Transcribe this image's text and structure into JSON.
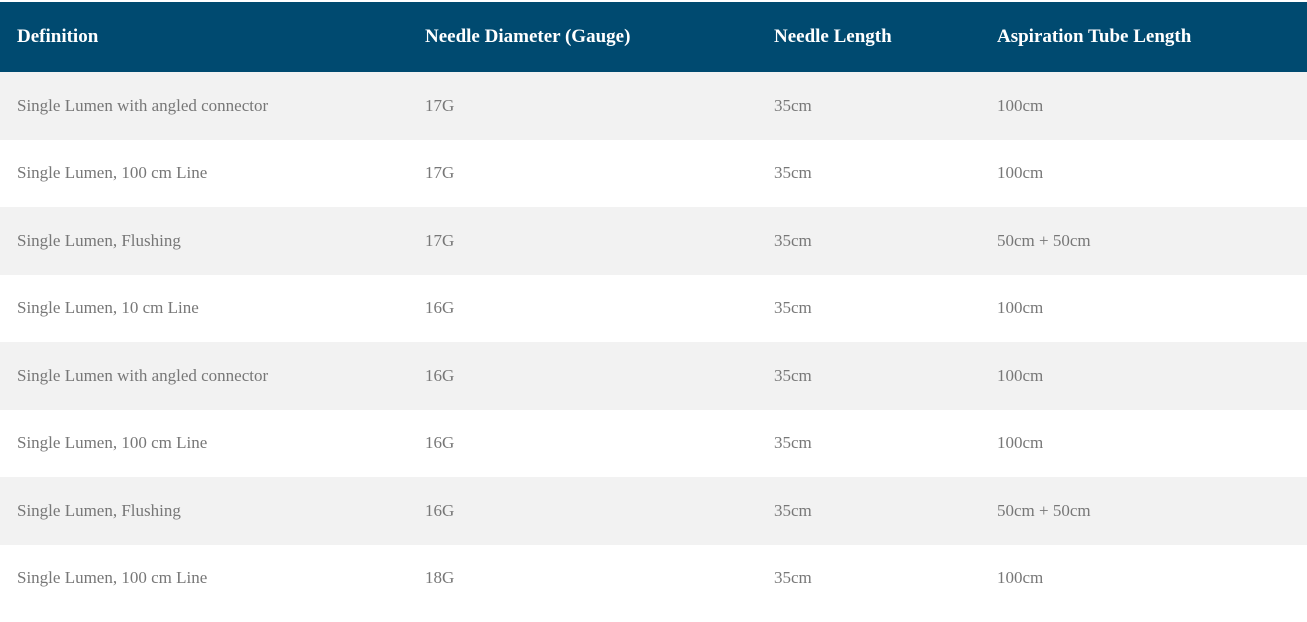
{
  "table": {
    "headers": [
      "Definition",
      "Needle Diameter (Gauge)",
      "Needle Length",
      "Aspiration Tube Length"
    ],
    "rows": [
      [
        "Single Lumen with angled connector",
        "17G",
        "35cm",
        "100cm"
      ],
      [
        "Single Lumen, 100 cm Line",
        "17G",
        "35cm",
        "100cm"
      ],
      [
        "Single Lumen, Flushing",
        "17G",
        "35cm",
        "50cm + 50cm"
      ],
      [
        "Single Lumen, 10 cm Line",
        "16G",
        "35cm",
        "100cm"
      ],
      [
        "Single Lumen with angled connector",
        "16G",
        "35cm",
        "100cm"
      ],
      [
        "Single Lumen, 100 cm Line",
        "16G",
        "35cm",
        "100cm"
      ],
      [
        "Single Lumen, Flushing",
        "16G",
        "35cm",
        "50cm + 50cm"
      ],
      [
        "Single Lumen, 100 cm Line",
        "18G",
        "35cm",
        "100cm"
      ]
    ]
  },
  "colors": {
    "header_bg": "#004a70",
    "header_text": "#ffffff",
    "row_odd_bg": "#f2f2f2",
    "row_even_bg": "#ffffff",
    "cell_text": "#777777"
  }
}
